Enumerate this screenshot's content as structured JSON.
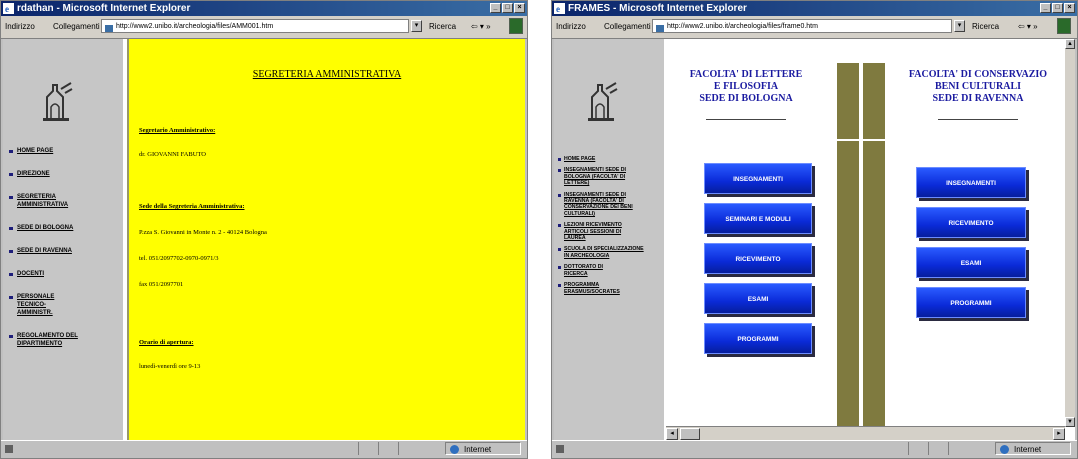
{
  "window1": {
    "title": "rdathan - Microsoft Internet Explorer",
    "address_label": "Indirizzo",
    "links_label": "Collegamenti",
    "url": "http://www2.unibo.it/archeologia/files/AMM001.htm",
    "search_label": "Ricerca",
    "nav": [
      "HOME PAGE",
      "DIREZIONE",
      "SEGRETERIA AMMINISTRATIVA",
      "SEDE DI BOLOGNA",
      "SEDE DI RAVENNA",
      "DOCENTI",
      "PERSONALE TECNICO-AMMINISTR.",
      "REGOLAMENTO DEL DIPARTIMENTO"
    ],
    "heading": "SEGRETERIA AMMINISTRATIVA",
    "sections": [
      {
        "label": "Segretario Amministrativo:",
        "lines": [
          "dr. GIOVANNI FABUTO"
        ]
      },
      {
        "label": "Sede della Segreteria Amministrativa:",
        "lines": [
          "P.zza S. Giovanni in Monte n. 2 - 40124 Bologna",
          "tel. 051/2097702-0970-0971/3",
          "fax 051/2097701"
        ]
      },
      {
        "label": "Orario di apertura:",
        "lines": [
          "lunedì-venerdì ore 9-13"
        ]
      }
    ],
    "status_zone": "Internet"
  },
  "window2": {
    "title": "FRAMES - Microsoft Internet Explorer",
    "address_label": "Indirizzo",
    "links_label": "Collegamenti",
    "url": "http://www2.unibo.it/archeologia/files/frame0.htm",
    "search_label": "Ricerca",
    "nav": [
      "HOME PAGE",
      "INSEGNAMENTI SEDE DI BOLOGNA (FACOLTA' DI LETTERE)",
      "INSEGNAMENTI SEDE DI RAVENNA (FACOLTA' DI CONSERVAZIONE DEI BENI CULTURALI)",
      "LEZIONI RICEVIMENTO ARTICOLI SESSIONI DI LAUREA",
      "SCUOLA DI SPECIALIZZAZIONE IN ARCHEOLOGIA",
      "DOTTORATO DI RICERCA",
      "PROGRAMMA ERASMUS/SOCRATES"
    ],
    "left_heading": [
      "FACOLTA' DI LETTERE",
      "E FILOSOFIA",
      "SEDE DI BOLOGNA"
    ],
    "right_heading": [
      "FACOLTA' DI CONSERVAZIO",
      "BENI CULTURALI",
      "SEDE DI RAVENNA"
    ],
    "left_buttons": [
      "INSEGNAMENTI",
      "SEMINARI E MODULI",
      "RICEVIMENTO",
      "ESAMI",
      "PROGRAMMI"
    ],
    "right_buttons": [
      "INSEGNAMENTI",
      "RICEVIMENTO",
      "ESAMI",
      "PROGRAMMI"
    ],
    "status_zone": "Internet"
  },
  "colors": {
    "yellow_panel": "#ffff00",
    "title_bar": "#0a246a",
    "button_blue": "#0a2ad8",
    "pillar": "#7f7a3f",
    "heading_blue": "#1a1aa0"
  }
}
